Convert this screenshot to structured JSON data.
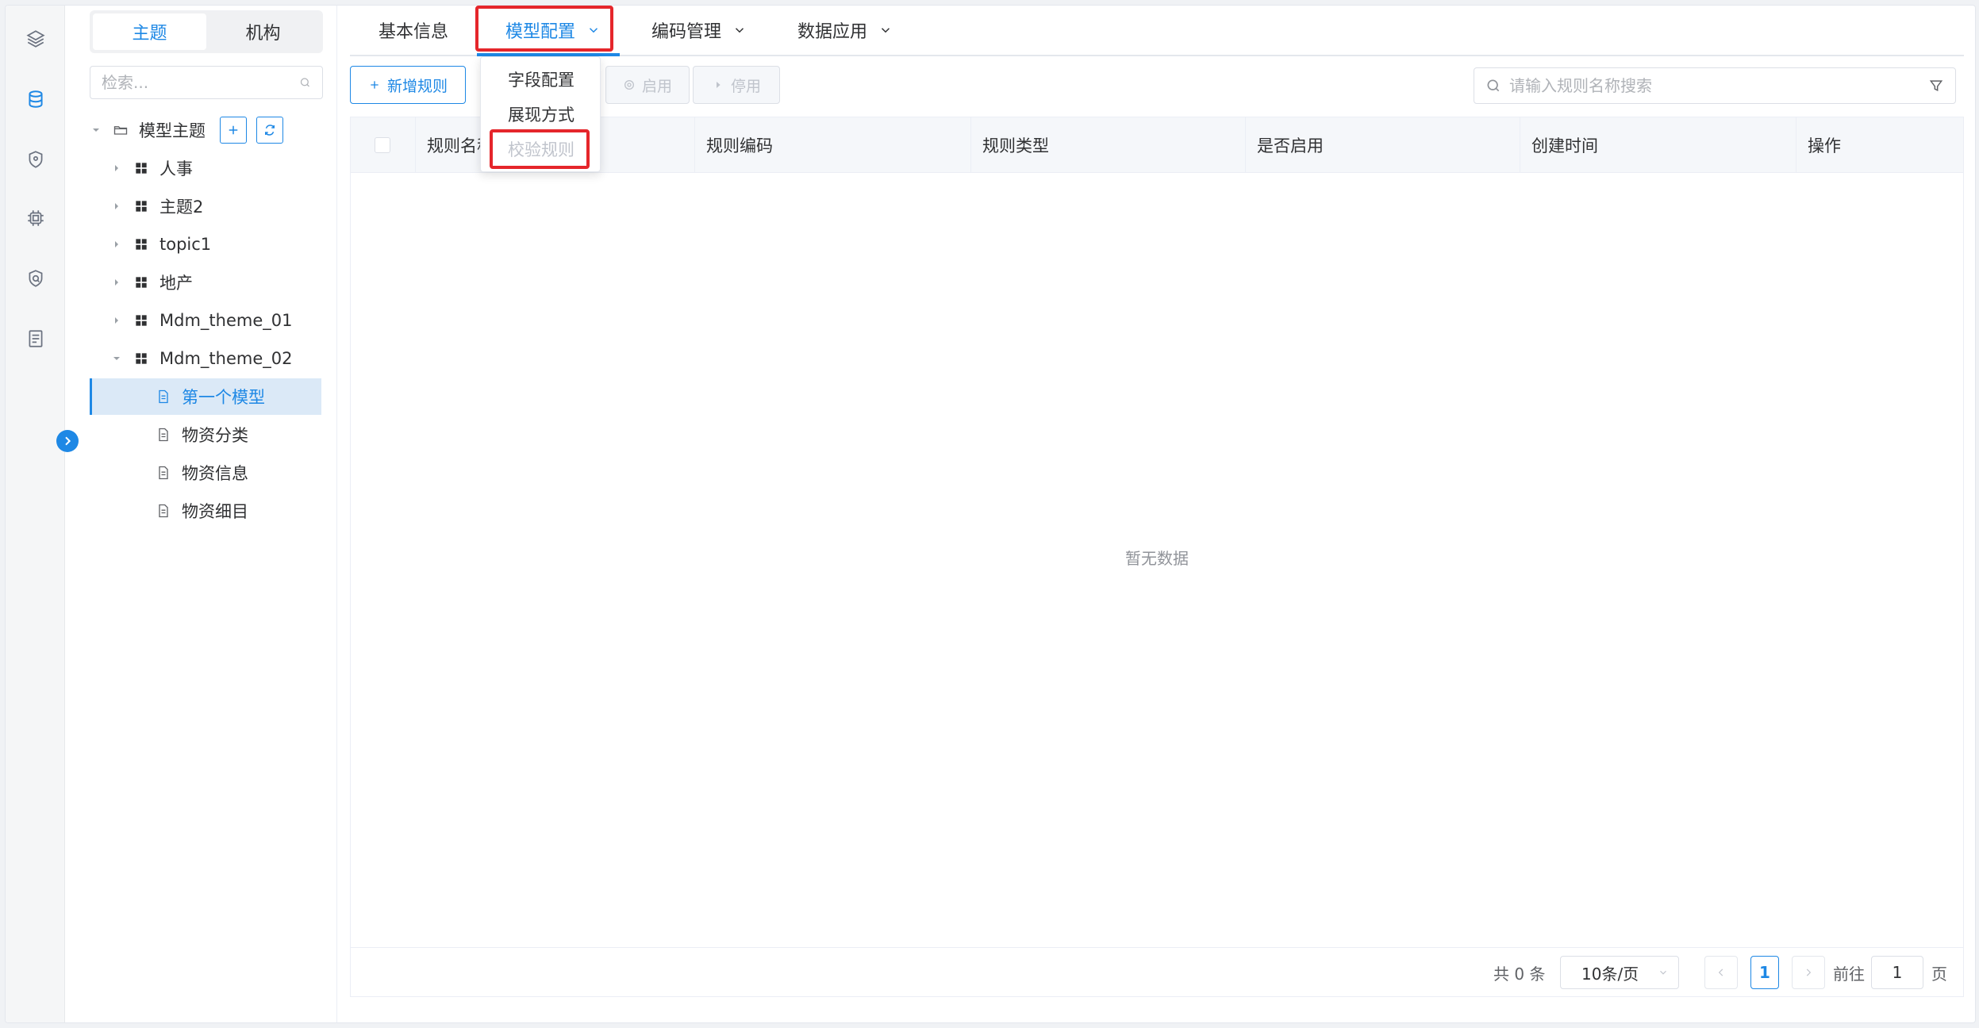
{
  "tree": {
    "segments": [
      {
        "label": "主题",
        "active": true
      },
      {
        "label": "机构",
        "active": false
      }
    ],
    "search_placeholder": "检索...",
    "root": {
      "label": "模型主题"
    },
    "themes": [
      {
        "label": "人事",
        "expanded": false
      },
      {
        "label": "主题2",
        "expanded": false
      },
      {
        "label": "topic1",
        "expanded": false
      },
      {
        "label": "地产",
        "expanded": false
      },
      {
        "label": "Mdm_theme_01",
        "expanded": false
      },
      {
        "label": "Mdm_theme_02",
        "expanded": true
      }
    ],
    "models": [
      {
        "label": "第一个模型",
        "selected": true
      },
      {
        "label": "物资分类",
        "selected": false
      },
      {
        "label": "物资信息",
        "selected": false
      },
      {
        "label": "物资细目",
        "selected": false
      }
    ]
  },
  "tabs": [
    {
      "label": "基本信息",
      "active": false,
      "dropdown": false
    },
    {
      "label": "模型配置",
      "active": true,
      "dropdown": true
    },
    {
      "label": "编码管理",
      "active": false,
      "dropdown": true
    },
    {
      "label": "数据应用",
      "active": false,
      "dropdown": true
    }
  ],
  "dropdown_menu": [
    {
      "label": "字段配置",
      "disabled": false
    },
    {
      "label": "展现方式",
      "disabled": false
    },
    {
      "label": "校验规则",
      "disabled": true
    }
  ],
  "toolbar": {
    "add_label": "新增规则",
    "enable_label": "启用",
    "disable_label": "停用"
  },
  "search": {
    "placeholder": "请输入规则名称搜索"
  },
  "table": {
    "columns": [
      "规则名称",
      "规则编码",
      "规则类型",
      "是否启用",
      "创建时间",
      "操作"
    ],
    "rows": [],
    "empty_text": "暂无数据"
  },
  "pagination": {
    "total_text": "共 0 条",
    "page_size": "10条/页",
    "current_page": "1",
    "goto_label": "前往",
    "goto_value": "1",
    "page_suffix": "页"
  },
  "colors": {
    "accent": "#1e88e5",
    "highlight_box": "#e5262b"
  }
}
